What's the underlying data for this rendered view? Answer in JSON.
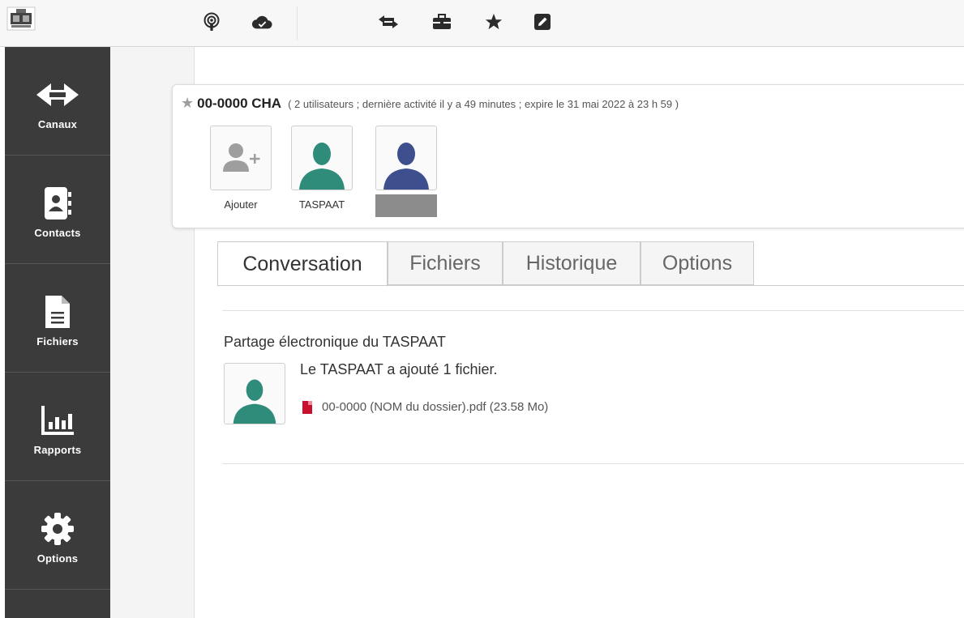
{
  "topbar": {
    "icons": [
      "podcast-icon",
      "cloud-icon",
      "exchange-arrows-icon",
      "briefcase-icon",
      "star-icon",
      "edit-icon"
    ]
  },
  "sidebar": {
    "items": [
      {
        "label": "Canaux",
        "icon": "exchange-arrows-icon"
      },
      {
        "label": "Contacts",
        "icon": "contact-book-icon"
      },
      {
        "label": "Fichiers",
        "icon": "file-icon"
      },
      {
        "label": "Rapports",
        "icon": "bar-chart-icon"
      },
      {
        "label": "Options",
        "icon": "gear-icon"
      }
    ]
  },
  "channel": {
    "name": "00-0000 CHA",
    "meta": "( 2 utilisateurs ; dernière activité il y a 49 minutes ; expire le 31 mai 2022 à 23 h 59 )",
    "members": [
      {
        "label": "Ajouter"
      },
      {
        "label": "TASPAAT"
      },
      {
        "label": ""
      }
    ]
  },
  "tabs": [
    "Conversation",
    "Fichiers",
    "Historique",
    "Options"
  ],
  "conversation": {
    "title": "Partage électronique du TASPAAT",
    "message": "Le TASPAAT a ajouté 1 fichier.",
    "file": "00-0000 (NOM du dossier).pdf (23.58 Mo)"
  },
  "colors": {
    "sidebar": "#3b3b3b",
    "avatar_teal": "#2f8c7a",
    "avatar_blue": "#3d4f8c",
    "avatar_gray": "#9e9e9e",
    "pdf_red": "#c8102e"
  }
}
